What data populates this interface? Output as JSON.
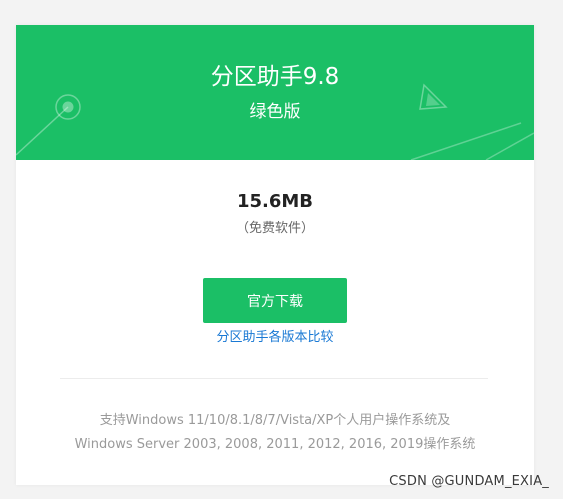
{
  "colors": {
    "accent": "#1bbf66",
    "link": "#1a79d4",
    "muted_text": "#9a9a9a"
  },
  "product": {
    "title": "分区助手9.8",
    "edition": "绿色版"
  },
  "download": {
    "file_size": "15.6MB",
    "license_note": "（免费软件）",
    "button_label": "官方下载",
    "compare_link": "分区助手各版本比较"
  },
  "system_requirements": {
    "line1": "支持Windows 11/10/8.1/8/7/Vista/XP个人用户操作系统及",
    "line2": "Windows Server 2003, 2008, 2011, 2012, 2016, 2019操作系统"
  },
  "watermark": "CSDN @GUNDAM_EXIA_"
}
